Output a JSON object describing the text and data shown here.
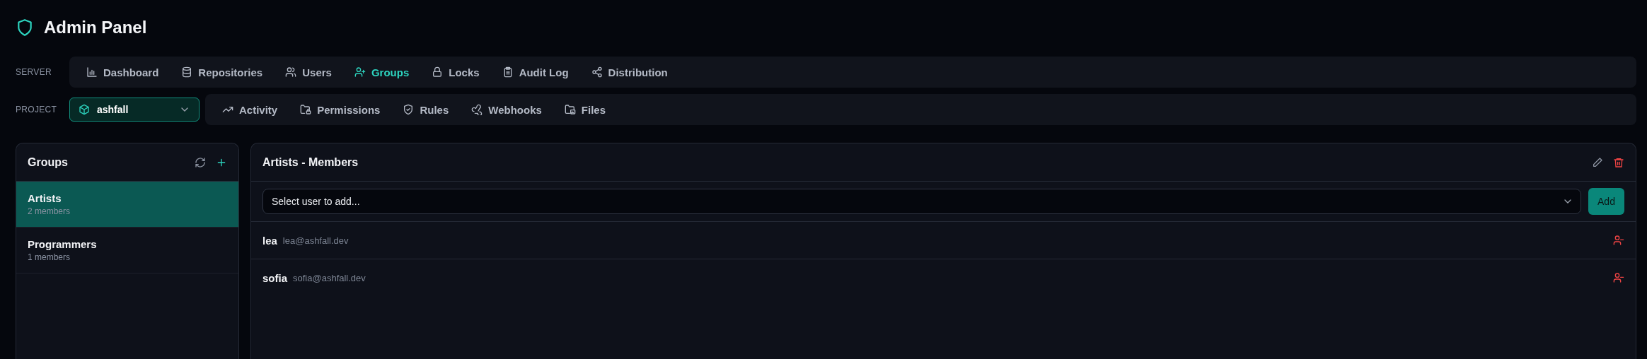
{
  "header": {
    "title": "Admin Panel"
  },
  "server_nav": {
    "label": "SERVER",
    "tabs": [
      {
        "label": "Dashboard",
        "selected": false
      },
      {
        "label": "Repositories",
        "selected": false
      },
      {
        "label": "Users",
        "selected": false
      },
      {
        "label": "Groups",
        "selected": true
      },
      {
        "label": "Locks",
        "selected": false
      },
      {
        "label": "Audit Log",
        "selected": false
      },
      {
        "label": "Distribution",
        "selected": false
      }
    ]
  },
  "project_nav": {
    "label": "PROJECT",
    "project_select": {
      "value": "ashfall"
    },
    "tabs": [
      {
        "label": "Activity",
        "selected": false
      },
      {
        "label": "Permissions",
        "selected": false
      },
      {
        "label": "Rules",
        "selected": false
      },
      {
        "label": "Webhooks",
        "selected": false
      },
      {
        "label": "Files",
        "selected": false
      }
    ]
  },
  "groups_panel": {
    "title": "Groups",
    "groups": [
      {
        "name": "Artists",
        "count": "2 members",
        "selected": true
      },
      {
        "name": "Programmers",
        "count": "1 members",
        "selected": false
      }
    ]
  },
  "members_panel": {
    "title": "Artists - Members",
    "user_select": {
      "placeholder": "Select user to add..."
    },
    "add_button": "Add",
    "members": [
      {
        "name": "lea",
        "email": "lea@ashfall.dev"
      },
      {
        "name": "sofia",
        "email": "sofia@ashfall.dev"
      }
    ]
  }
}
